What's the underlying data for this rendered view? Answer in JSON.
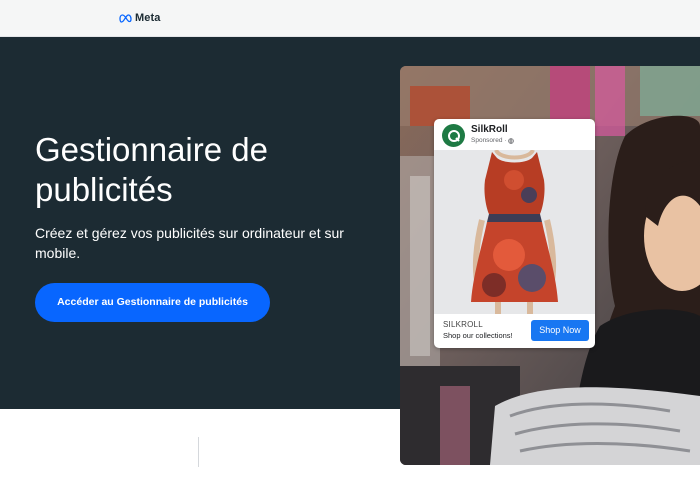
{
  "header": {
    "logo_text": "Meta",
    "logo_icon": "meta-infinity-icon"
  },
  "hero": {
    "title": "Gestionnaire de publicités",
    "subtitle": "Créez et gérez vos publicités sur ordinateur et sur mobile.",
    "cta_label": "Accéder au Gestionnaire de publicités"
  },
  "ad_preview": {
    "brand": "SilkRoll",
    "sponsored": "Sponsored · ",
    "shop_name": "SILKROLL",
    "shop_description": "Shop our collections!",
    "shop_button": "Shop Now"
  },
  "colors": {
    "hero_bg": "#1c2b33",
    "cta": "#0866ff",
    "shop_button": "#1877f2"
  }
}
